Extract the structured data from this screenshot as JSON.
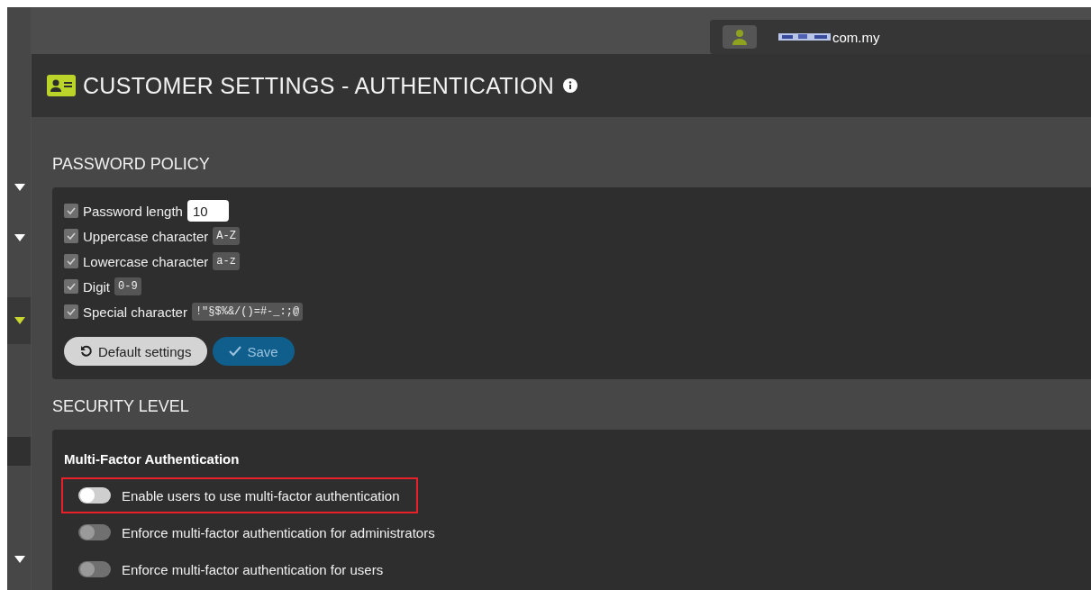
{
  "account": {
    "domain": "com.my"
  },
  "sidebar": {
    "items": [
      {
        "selected": false
      },
      {
        "selected": false
      },
      {
        "selected": true
      },
      {
        "selected": false
      }
    ]
  },
  "header": {
    "title": "CUSTOMER SETTINGS - AUTHENTICATION"
  },
  "password_policy": {
    "title": "PASSWORD POLICY",
    "rules": [
      {
        "label": "Password length",
        "checked": true,
        "kind": "input",
        "value": "10"
      },
      {
        "label": "Uppercase character",
        "checked": true,
        "kind": "tag",
        "value": "A-Z"
      },
      {
        "label": "Lowercase character",
        "checked": true,
        "kind": "tag",
        "value": "a-z"
      },
      {
        "label": "Digit",
        "checked": true,
        "kind": "tag",
        "value": "0-9"
      },
      {
        "label": "Special character",
        "checked": true,
        "kind": "tag",
        "value": "!\"§$%&/()=#-_:;@"
      }
    ],
    "buttons": [
      {
        "label": "Default settings",
        "kind": "reset"
      },
      {
        "label": "Save",
        "kind": "save"
      }
    ]
  },
  "security_level": {
    "title": "SECURITY LEVEL",
    "subtitle": "Multi-Factor Authentication",
    "toggles": [
      {
        "label": "Enable users to use multi-factor authentication",
        "on": false,
        "disabled": false,
        "highlighted": true
      },
      {
        "label": "Enforce multi-factor authentication for administrators",
        "on": false,
        "disabled": true,
        "highlighted": false
      },
      {
        "label": "Enforce multi-factor authentication for users",
        "on": false,
        "disabled": true,
        "highlighted": false
      }
    ]
  }
}
